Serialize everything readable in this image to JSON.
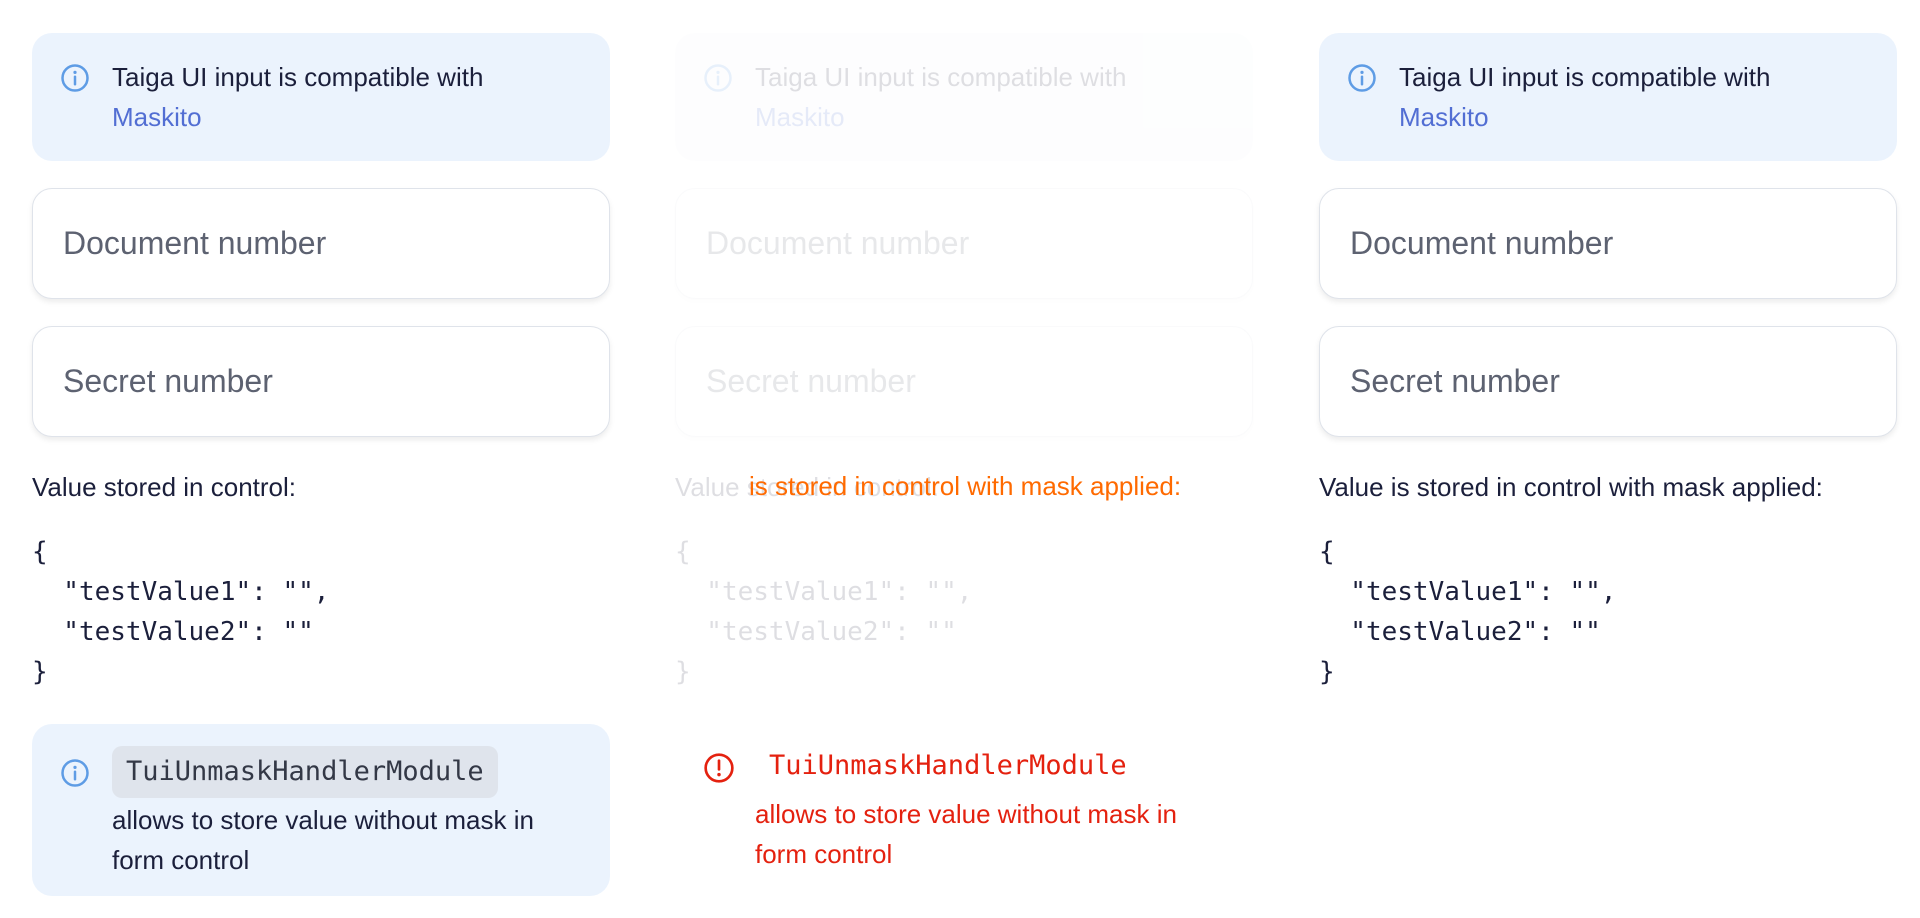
{
  "columns": [
    {
      "notice": {
        "text": "Taiga UI input is compatible with",
        "link": "Maskito"
      },
      "fields": {
        "document_placeholder": "Document number",
        "secret_placeholder": "Secret number"
      },
      "value_label": "Value stored in control:",
      "json_value": "{\n  \"testValue1\": \"\",\n  \"testValue2\": \"\"\n}",
      "bottom_notice": {
        "code": "TuiUnmaskHandlerModule",
        "text": "allows to store value without mask in form control"
      }
    },
    {
      "notice": {
        "text": "Taiga UI input is compatible with",
        "link": "Maskito"
      },
      "fields": {
        "document_placeholder": "Document number",
        "secret_placeholder": "Secret number"
      },
      "value_label": "Value stored in control:",
      "json_value": "{\n  \"testValue1\": \"\",\n  \"testValue2\": \"\"\n}",
      "overlay_label": "is stored in control with mask applied:",
      "bottom_notice": {
        "code": "TuiUnmaskHandlerModule",
        "text": "allows to store value without mask in form control"
      }
    },
    {
      "notice": {
        "text": "Taiga UI input is compatible with",
        "link": "Maskito"
      },
      "fields": {
        "document_placeholder": "Document number",
        "secret_placeholder": "Secret number"
      },
      "value_label": "Value is stored in control with mask applied:",
      "json_value": "{\n  \"testValue1\": \"\",\n  \"testValue2\": \"\"\n}"
    }
  ],
  "icons": {
    "info": "info-circle-icon",
    "warning": "warning-circle-icon"
  },
  "colors": {
    "notice_bg": "#ebf3fd",
    "link": "#526ed3",
    "info_icon": "#5e9ce5",
    "error": "#e4210f",
    "overlay_orange": "#ff6a00"
  }
}
